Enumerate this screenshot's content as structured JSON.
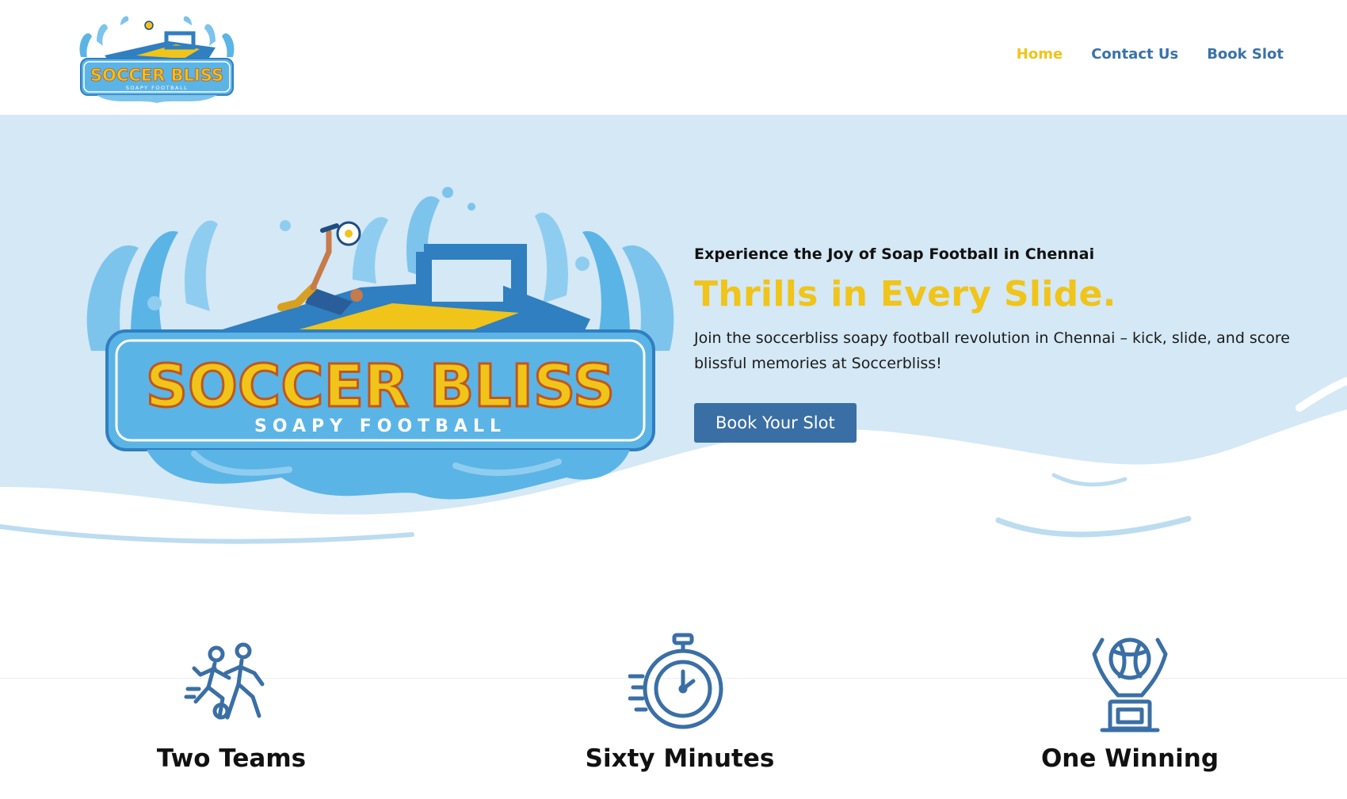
{
  "header": {
    "logo_alt": "Soccer Bliss Soapy Football logo",
    "logo_text": "SOCCER BLISS",
    "logo_subtext": "SOAPY FOOTBALL",
    "nav": [
      {
        "label": "Home",
        "active": true
      },
      {
        "label": "Contact Us",
        "active": false
      },
      {
        "label": "Book Slot",
        "active": false
      }
    ]
  },
  "hero": {
    "logo_text": "SOCCER BLISS",
    "logo_subtext": "SOAPY FOOTBALL",
    "eyebrow": "Experience the Joy of Soap Football in Chennai",
    "headline": "Thrills in Every Slide.",
    "lead": "Join the soccerbliss soapy football revolution in Chennai – kick, slide, and score blissful memories at Soccerbliss!",
    "cta_label": "Book Your Slot"
  },
  "features": [
    {
      "icon": "players-icon",
      "title": "Two Teams"
    },
    {
      "icon": "stopwatch-icon",
      "title": "Sixty Minutes"
    },
    {
      "icon": "trophy-icon",
      "title": "One Winning"
    }
  ],
  "colors": {
    "accent_yellow": "#f0c419",
    "brand_blue": "#3a6fa5",
    "hero_bg": "#d4e8f5",
    "logo_blue": "#5bb4e6"
  }
}
